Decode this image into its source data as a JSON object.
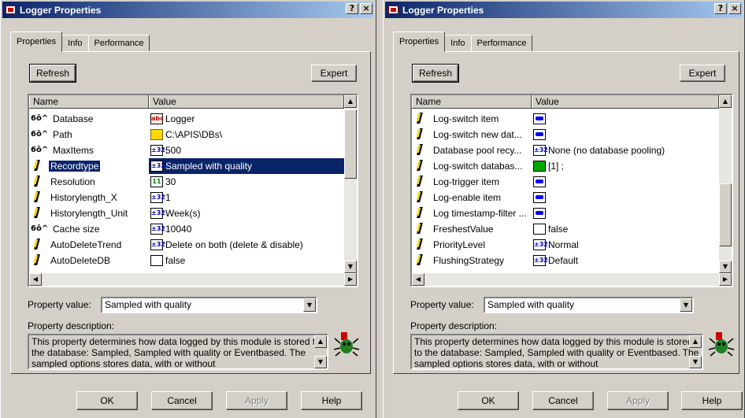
{
  "dialogs": [
    {
      "title": "Logger Properties",
      "tabs": [
        "Properties",
        "Info",
        "Performance"
      ],
      "refresh": "Refresh",
      "expert": "Expert",
      "columns": [
        "Name",
        "Value"
      ],
      "rows": [
        {
          "name": "Database",
          "name_icon": "glasses-icon",
          "value": "Logger",
          "value_icon": "abc-icon"
        },
        {
          "name": "Path",
          "name_icon": "glasses-icon",
          "value": "C:\\APIS\\DBs\\",
          "value_icon": "folder-icon"
        },
        {
          "name": "MaxItems",
          "name_icon": "glasses-icon",
          "value": "500",
          "value_icon": "int32-icon"
        },
        {
          "name": "Recordtype",
          "name_icon": "pencil-icon",
          "value": "Sampled with quality",
          "value_icon": "enum-icon",
          "selected": true
        },
        {
          "name": "Resolution",
          "name_icon": "pencil-icon",
          "value": "30",
          "value_icon": "int11-icon"
        },
        {
          "name": "Historylength_X",
          "name_icon": "pencil-icon",
          "value": "1",
          "value_icon": "int32-icon"
        },
        {
          "name": "Historylength_Unit",
          "name_icon": "pencil-icon",
          "value": "Week(s)",
          "value_icon": "enum-icon"
        },
        {
          "name": "Cache size",
          "name_icon": "glasses-icon",
          "value": "10040",
          "value_icon": "int32-icon"
        },
        {
          "name": "AutoDeleteTrend",
          "name_icon": "pencil-icon",
          "value": "Delete on both (delete & disable)",
          "value_icon": "enum-icon"
        },
        {
          "name": "AutoDeleteDB",
          "name_icon": "pencil-icon",
          "value": "false",
          "value_icon": "bool-icon"
        }
      ],
      "property_value_label": "Property value:",
      "property_value": "Sampled with quality",
      "property_desc_label": "Property description:",
      "property_desc": "This property determines how data logged by this module is stored to the database: Sampled, Sampled with quality or Eventbased. The sampled options stores data, with or without",
      "ok": "OK",
      "cancel": "Cancel",
      "apply": "Apply",
      "help": "Help"
    },
    {
      "title": "Logger Properties",
      "tabs": [
        "Properties",
        "Info",
        "Performance"
      ],
      "refresh": "Refresh",
      "expert": "Expert",
      "columns": [
        "Name",
        "Value"
      ],
      "rows": [
        {
          "name": "Log-switch item",
          "name_icon": "pencil-icon",
          "value": "",
          "value_icon": "item-icon"
        },
        {
          "name": "Log-switch new dat...",
          "name_icon": "pencil-icon",
          "value": "",
          "value_icon": "item-icon"
        },
        {
          "name": "Database pool recy...",
          "name_icon": "pencil-icon",
          "value": "None (no database pooling)",
          "value_icon": "enum-icon"
        },
        {
          "name": "Log-switch databas...",
          "name_icon": "pencil-icon",
          "value": "[1] ;",
          "value_icon": "array-icon"
        },
        {
          "name": "Log-trigger item",
          "name_icon": "pencil-icon",
          "value": "",
          "value_icon": "item-icon"
        },
        {
          "name": "Log-enable item",
          "name_icon": "pencil-icon",
          "value": "",
          "value_icon": "item-icon"
        },
        {
          "name": "Log timestamp-filter ...",
          "name_icon": "pencil-icon",
          "value": "",
          "value_icon": "item-icon"
        },
        {
          "name": "FreshestValue",
          "name_icon": "pencil-icon",
          "value": "false",
          "value_icon": "bool-icon"
        },
        {
          "name": "PriorityLevel",
          "name_icon": "pencil-icon",
          "value": "Normal",
          "value_icon": "enum-icon"
        },
        {
          "name": "FlushingStrategy",
          "name_icon": "pencil-icon",
          "value": "Default",
          "value_icon": "int32-icon"
        }
      ],
      "property_value_label": "Property value:",
      "property_value": "Sampled with quality",
      "property_desc_label": "Property description:",
      "property_desc": "This property determines how data logged by this module is stored to the database: Sampled, Sampled with quality or Eventbased. The sampled options stores data, with or without",
      "ok": "OK",
      "cancel": "Cancel",
      "apply": "Apply",
      "help": "Help"
    }
  ],
  "colors": {
    "face": "#d4d0c8",
    "title_start": "#0a246a",
    "title_end": "#a6caf0",
    "selection": "#0a246a"
  },
  "icon_text": {
    "help": "?",
    "close": "×",
    "int32": "±32",
    "abc": "abc",
    "int11": "11",
    "scroll_up": "▲",
    "scroll_down": "▼",
    "scroll_left": "◀",
    "scroll_right": "▶",
    "dropdown": "▼",
    "glasses": "6ô^"
  }
}
